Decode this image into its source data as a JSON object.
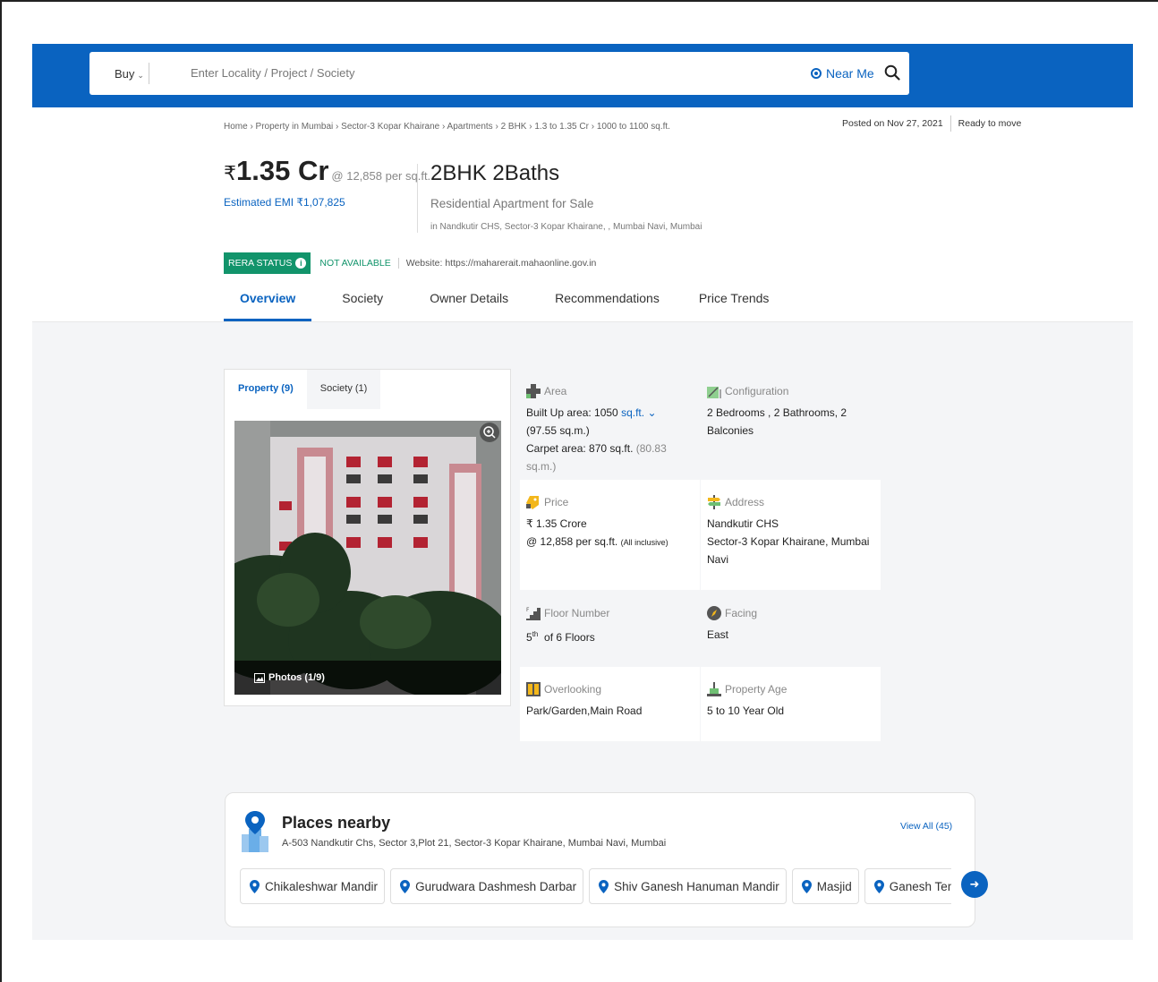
{
  "search": {
    "buy_label": "Buy",
    "placeholder": "Enter Locality / Project / Society",
    "near_me": "Near Me"
  },
  "breadcrumb": "Home › Property in Mumbai › Sector-3 Kopar Khairane › Apartments › 2 BHK › 1.3 to 1.35 Cr › 1000 to 1100 sq.ft.",
  "posted": "Posted on Nov 27, 2021",
  "status": "Ready to move",
  "price": {
    "currency": "₹",
    "amount": "1.35 Cr",
    "per_sqft": "@ 12,858 per sq.ft.",
    "emi": "Estimated EMI ₹1,07,825"
  },
  "listing": {
    "title": "2BHK 2Baths",
    "subtitle": "Residential Apartment for Sale",
    "location": "in Nandkutir CHS, Sector-3 Kopar Khairane, , Mumbai Navi, Mumbai"
  },
  "rera": {
    "badge": "RERA STATUS",
    "value": "NOT AVAILABLE",
    "website": "Website: https://maharerait.mahaonline.gov.in"
  },
  "tabs": [
    "Overview",
    "Society",
    "Owner Details",
    "Recommendations",
    "Price Trends"
  ],
  "gallery": {
    "tabs": [
      "Property (9)",
      "Society (1)"
    ],
    "photos_label": "Photos (1/9)"
  },
  "details": {
    "area": {
      "label": "Area",
      "built_up": "Built Up area: 1050",
      "unit": "sq.ft.",
      "built_up_sqm": "(97.55 sq.m.)",
      "carpet": "Carpet area: 870 sq.ft.",
      "carpet_sqm": "(80.83 sq.m.)"
    },
    "configuration": {
      "label": "Configuration",
      "value": "2 Bedrooms , 2 Bathrooms, 2 Balconies"
    },
    "price": {
      "label": "Price",
      "value": "₹ 1.35 Crore",
      "per": "@ 12,858 per sq.ft.",
      "note": "(All inclusive)"
    },
    "address": {
      "label": "Address",
      "line1": "Nandkutir CHS",
      "line2": "Sector-3 Kopar Khairane, Mumbai Navi"
    },
    "floor": {
      "label": "Floor Number",
      "num": "5",
      "sup": "th",
      "rest": "of 6 Floors"
    },
    "facing": {
      "label": "Facing",
      "value": "East"
    },
    "overlooking": {
      "label": "Overlooking",
      "value": "Park/Garden,Main Road"
    },
    "age": {
      "label": "Property Age",
      "value": "5 to 10 Year Old"
    }
  },
  "places": {
    "title": "Places nearby",
    "address": "A-503 Nandkutir Chs, Sector 3,Plot 21, Sector-3 Kopar Khairane, Mumbai Navi, Mumbai",
    "view_all": "View All (45)",
    "items": [
      "Chikaleshwar Mandir",
      "Gurudwara Dashmesh Darbar",
      "Shiv Ganesh Hanuman Mandir",
      "Masjid",
      "Ganesh Temple"
    ]
  },
  "colors": {
    "brand_blue": "#0a63c0",
    "rera_green": "#12946b",
    "content_bg": "#f4f5f7"
  }
}
